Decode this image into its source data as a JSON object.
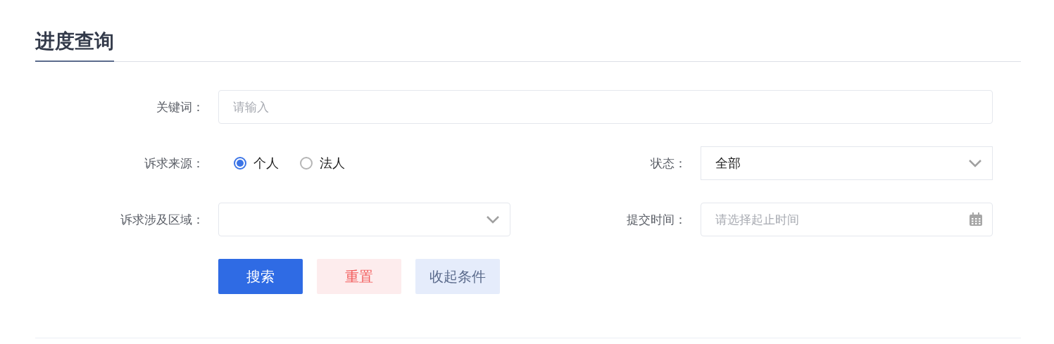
{
  "title": "进度查询",
  "keyword": {
    "label": "关键词：",
    "placeholder": "请输入"
  },
  "source": {
    "label": "诉求来源：",
    "options": [
      {
        "label": "个人",
        "selected": true
      },
      {
        "label": "法人",
        "selected": false
      }
    ]
  },
  "status": {
    "label": "状态：",
    "value": "全部"
  },
  "region": {
    "label": "诉求涉及区域："
  },
  "submit_time": {
    "label": "提交时间：",
    "placeholder": "请选择起止时间"
  },
  "buttons": [
    {
      "label": "搜索",
      "kind": "primary"
    },
    {
      "label": "重置",
      "kind": "danger"
    },
    {
      "label": "收起条件",
      "kind": "secondary"
    }
  ]
}
